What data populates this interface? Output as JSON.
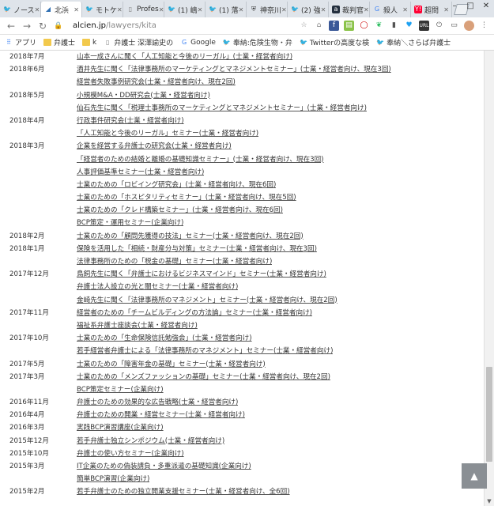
{
  "browser": {
    "tabs": [
      {
        "label": "ノース",
        "icon": "twitter-icon",
        "active": false
      },
      {
        "label": "北浜",
        "icon": "alcien-icon",
        "active": true
      },
      {
        "label": "モトケ",
        "icon": "twitter-icon",
        "active": false
      },
      {
        "label": "Profes",
        "icon": "page-icon",
        "active": false
      },
      {
        "label": "(1) 嶋",
        "icon": "twitter-icon",
        "active": false
      },
      {
        "label": "(1) 落",
        "icon": "twitter-icon",
        "active": false
      },
      {
        "label": "神奈川",
        "icon": "shield-icon",
        "active": false
      },
      {
        "label": "(2) 強",
        "icon": "twitter-icon",
        "active": false
      },
      {
        "label": "裁判官",
        "icon": "amazon-icon",
        "active": false
      },
      {
        "label": "殺人",
        "icon": "google-icon",
        "active": false
      },
      {
        "label": "超問",
        "icon": "yahoo-icon",
        "active": false
      }
    ],
    "url_host": "alcien.jp",
    "url_path": "/lawyers/kita",
    "bookmarks": [
      {
        "label": "アプリ",
        "icon": "apps-grid-icon"
      },
      {
        "label": "弁護士",
        "icon": "folder-icon"
      },
      {
        "label": "k",
        "icon": "folder-icon"
      },
      {
        "label": "弁護士 深澤諭史の",
        "icon": "page-icon"
      },
      {
        "label": "Google",
        "icon": "google-icon"
      },
      {
        "label": "奉納:危険生物・弁",
        "icon": "twitter-icon"
      },
      {
        "label": "Twitterの高度な検",
        "icon": "twitter-icon"
      },
      {
        "label": "奉納＼さらば弁護士",
        "icon": "twitter-icon"
      }
    ]
  },
  "seminars": [
    {
      "date": "2018年7月",
      "title": "山本一成さんに聞く「人工知能と今後のリーガル」(士業・経営者向け)"
    },
    {
      "date": "2018年6月",
      "title": "酒井先生に聞く「法律事務所のマーケティングとマネジメントセミナー」(士業・経営者向け、現在3回)"
    },
    {
      "date": "",
      "title": "経営者失敗事例研究会(士業・経営者向け、現在2回)"
    },
    {
      "date": "2018年5月",
      "title": "小規模M&A・DD研究会(士業・経営者向け)"
    },
    {
      "date": "",
      "title": "仙石先生に聞く「税理士事務所のマーケティングとマネジメントセミナー」(士業・経営者向け)"
    },
    {
      "date": "2018年4月",
      "title": "行政事件研究会(士業・経営者向け)"
    },
    {
      "date": "",
      "title": "「人工知能と今後のリーガル」セミナー(士業・経営者向け)"
    },
    {
      "date": "2018年3月",
      "title": "企業を経営する弁護士の研究会(士業・経営者向け)"
    },
    {
      "date": "",
      "title": "「経営者のための結婚と離婚の基礎知識セミナー」(士業・経営者向け、現在3回)"
    },
    {
      "date": "",
      "title": "人事評価基準セミナー(士業・経営者向け)"
    },
    {
      "date": "",
      "title": "士業のための「ロビイング研究会」(士業・経営者向け、現在6回)"
    },
    {
      "date": "",
      "title": "士業のための「ホスピタリティセミナー」(士業・経営者向け、現在5回)"
    },
    {
      "date": "",
      "title": "士業のための「クレド構築セミナー」(士業・経営者向け、現在6回)"
    },
    {
      "date": "",
      "title": "BCP策定・運用セミナー(企業向け)"
    },
    {
      "date": "2018年2月",
      "title": "士業のための「顧問先獲得の技法」セミナー(士業・経営者向け、現在2回)"
    },
    {
      "date": "2018年1月",
      "title": "保険を活用した「相続・財産分与対策」セミナー(士業・経営者向け、現在3回)"
    },
    {
      "date": "",
      "title": "法律事務所のための「税金の基礎」セミナー(士業・経営者向け)"
    },
    {
      "date": "2017年12月",
      "title": "鳥飼先生に聞く「弁護士におけるビジネスマインド」セミナー(士業・経営者向け)"
    },
    {
      "date": "",
      "title": "弁護士法人設立の光と闇セミナー(士業・経営者向け)"
    },
    {
      "date": "",
      "title": "金崎先生に聞く「法律事務所のマネジメント」セミナー(士業・経営者向け、現在2回)"
    },
    {
      "date": "2017年11月",
      "title": "経営者のための「チームビルディングの方法論」セミナー(士業・経営者向け)"
    },
    {
      "date": "",
      "title": "福祉系弁護士座談会(士業・経営者向け)"
    },
    {
      "date": "2017年10月",
      "title": "士業のための「生命保険信託勉強会」(士業・経営者向け)"
    },
    {
      "date": "",
      "title": "若手経営者弁護士による「法律事務所のマネジメント」セミナー(士業・経営者向け)"
    },
    {
      "date": "2017年5月",
      "title": "士業のための「障害年金の基礎」セミナー(士業・経営者向け)"
    },
    {
      "date": "2017年3月",
      "title": "士業のための「メンズファッションの基礎」セミナー(士業・経営者向け、現在2回)"
    },
    {
      "date": "",
      "title": "BCP策定セミナー(企業向け)"
    },
    {
      "date": "2016年11月",
      "title": "弁護士のための効果的な広告戦略(士業・経営者向け)"
    },
    {
      "date": "2016年4月",
      "title": "弁護士のための開業・経営セミナー(士業・経営者向け)"
    },
    {
      "date": "2016年3月",
      "title": "実践BCP演習講座(企業向け)"
    },
    {
      "date": "2015年12月",
      "title": "若手弁護士独立シンポジウム(士業・経営者向け)"
    },
    {
      "date": "2015年10月",
      "title": "弁護士の使い方セミナー(企業向け)"
    },
    {
      "date": "2015年3月",
      "title": "IT企業のための偽装請負・多重派遣の基礎知識(企業向け)"
    },
    {
      "date": "",
      "title": "簡単BCP演習(企業向け)"
    },
    {
      "date": "2015年2月",
      "title": "若手弁護士のための独立開業支援セミナー(士業・経営者向け、全6回)"
    }
  ],
  "colors": {
    "twitter": "#1da1f2",
    "alcien": "#2f6fb3",
    "amazon": "#232f3e",
    "yahoo": "#ff0033",
    "google": "#4285f4"
  }
}
